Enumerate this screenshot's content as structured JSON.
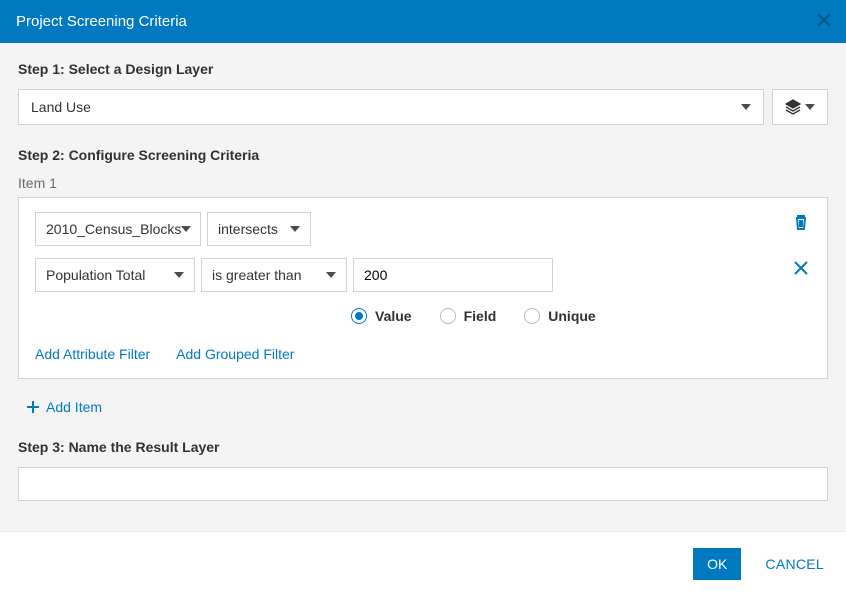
{
  "header": {
    "title": "Project Screening Criteria"
  },
  "step1": {
    "label": "Step 1: Select a Design Layer",
    "design_layer": "Land Use"
  },
  "step2": {
    "label": "Step 2: Configure Screening Criteria",
    "items": [
      {
        "title": "Item 1",
        "layer": "2010_Census_Blocks",
        "spatial_op": "intersects",
        "filters": [
          {
            "field": "Population Total",
            "condition": "is greater than",
            "value": "200"
          }
        ],
        "value_modes": [
          {
            "label": "Value",
            "checked": true
          },
          {
            "label": "Field",
            "checked": false
          },
          {
            "label": "Unique",
            "checked": false
          }
        ]
      }
    ],
    "actions": {
      "add_attr": "Add Attribute Filter",
      "add_grouped": "Add Grouped Filter",
      "add_item": "Add Item"
    }
  },
  "step3": {
    "label": "Step 3: Name the Result Layer",
    "value": ""
  },
  "footer": {
    "ok": "OK",
    "cancel": "CANCEL"
  }
}
